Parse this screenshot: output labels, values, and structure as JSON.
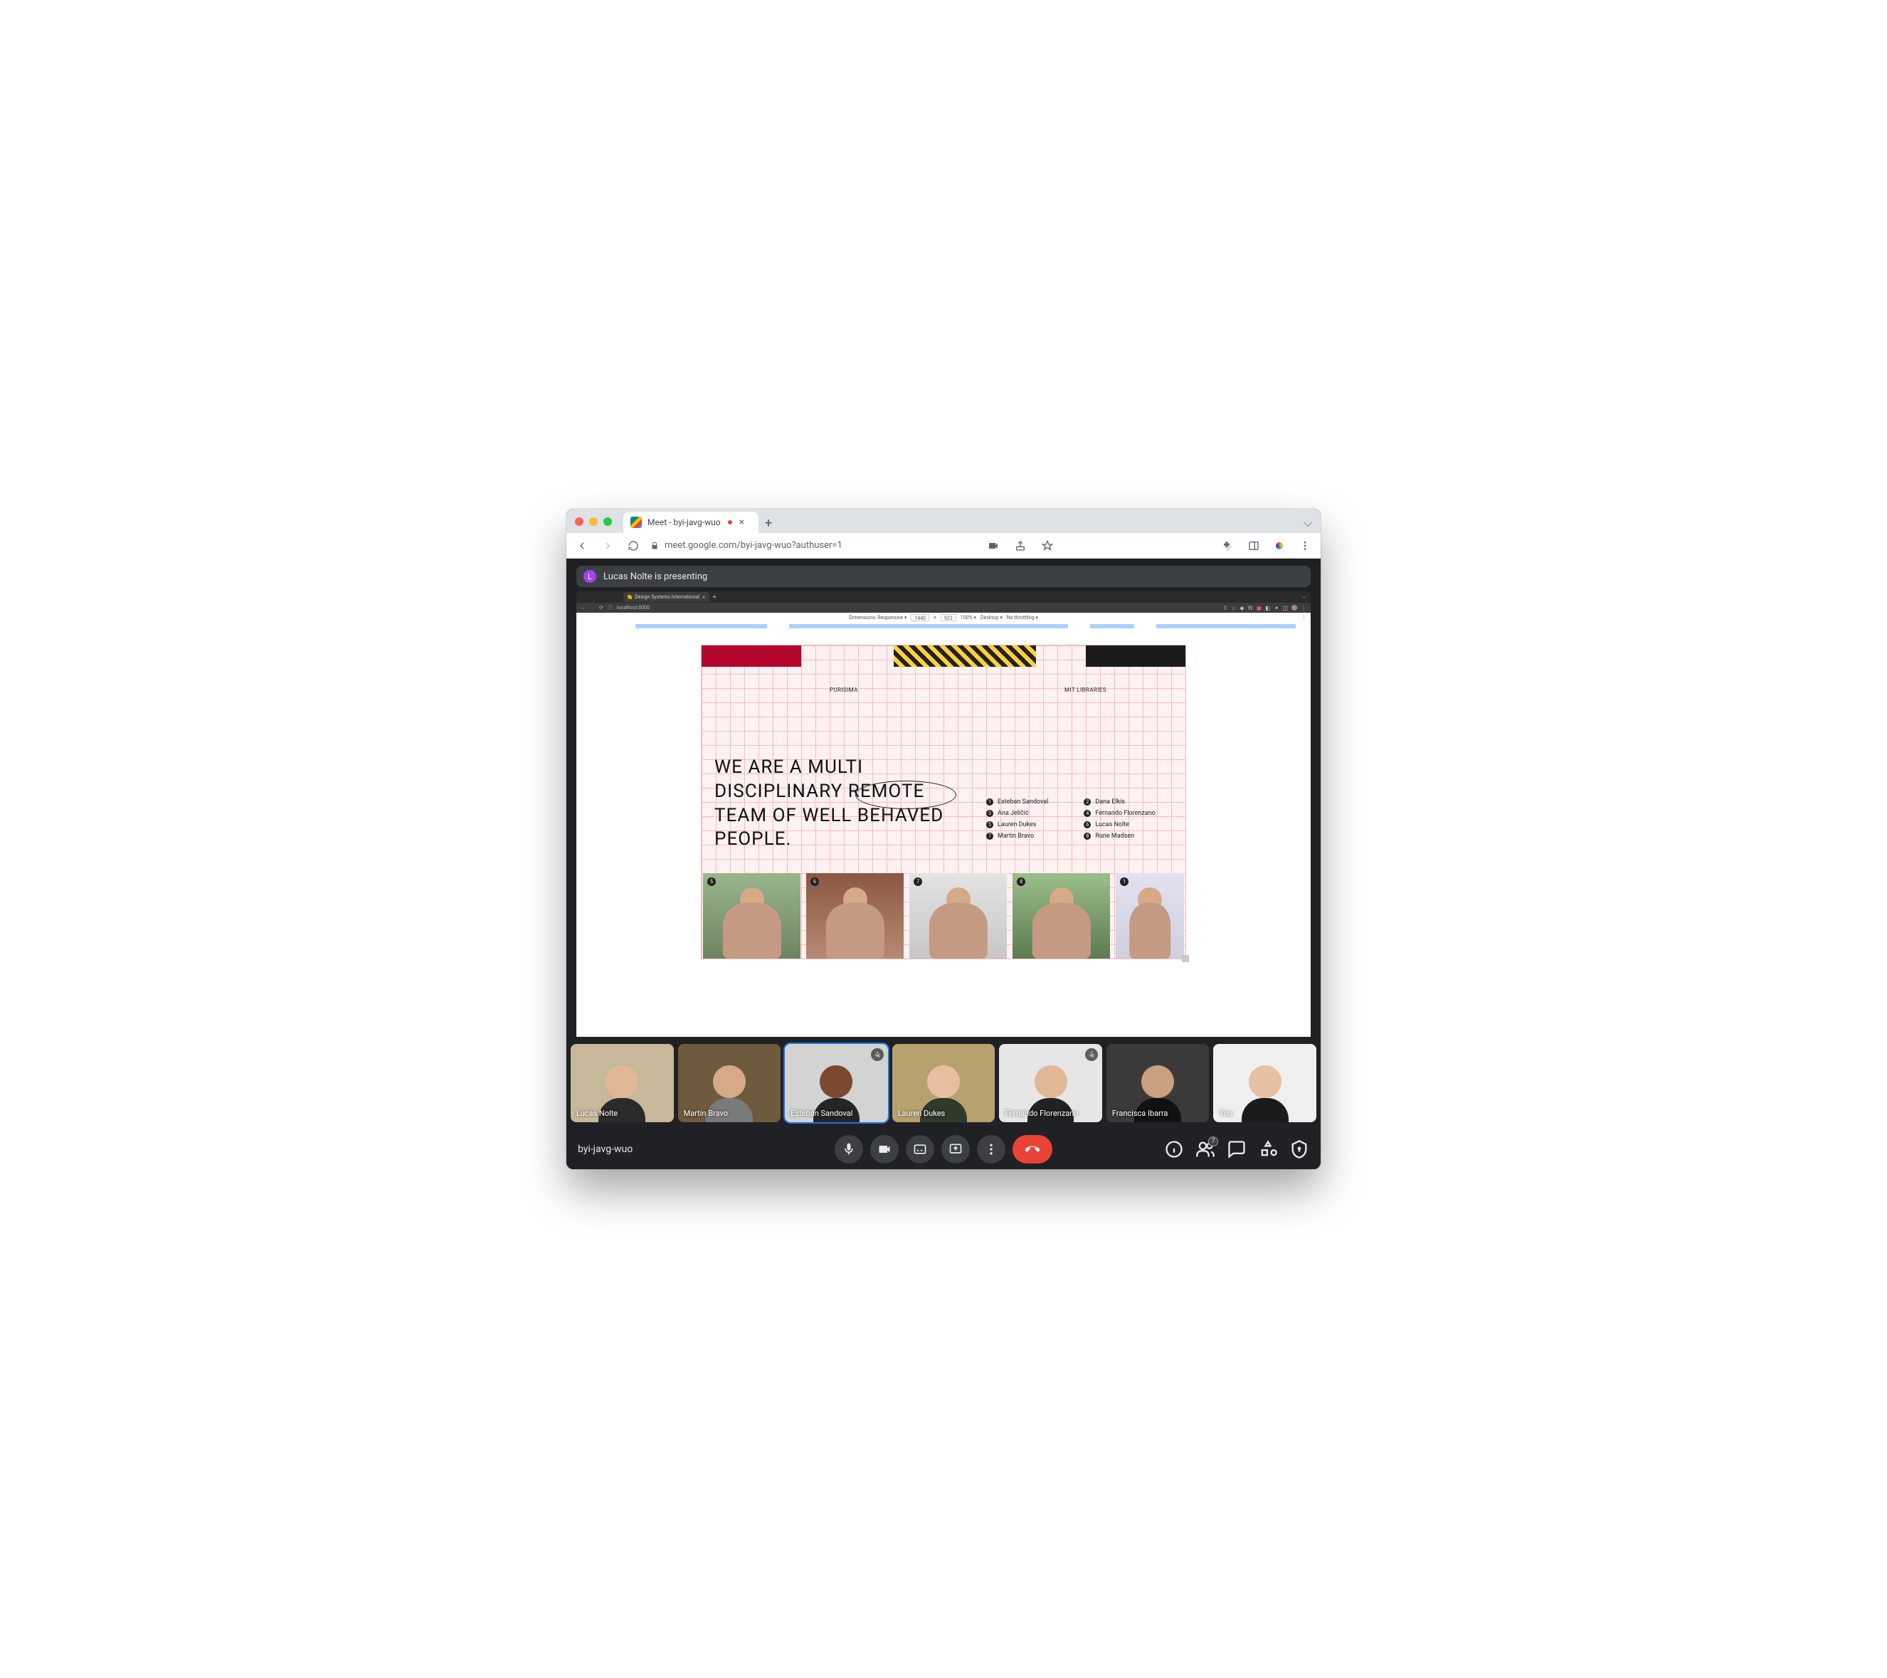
{
  "browser": {
    "tab_title": "Meet - byi-javg-wuo",
    "url": "meet.google.com/byi-javg-wuo?authuser=1"
  },
  "meet": {
    "banner": "Lucas Nolte is presenting",
    "banner_initial": "L",
    "meeting_code": "byi-javg-wuo",
    "participant_count": "7"
  },
  "inner_browser": {
    "tab_title": "Design Systems International",
    "url": "localhost:8000",
    "devtools": {
      "dimensions_label": "Dimensions: Responsive ▾",
      "width": "1440",
      "height": "923",
      "zoom": "100% ▾",
      "device": "Desktop ▾",
      "throttle": "No throttling ▾"
    }
  },
  "page": {
    "projects": {
      "label1": "PURISIMA",
      "label2": "MIT LIBRARIES"
    },
    "headline": "WE ARE A MULTI DISCIPLINARY REMOTE TEAM OF WELL BEHAVED PEOPLE.",
    "team_col1": [
      {
        "n": "1",
        "name": "Esteban Sandoval"
      },
      {
        "n": "3",
        "name": "Ana Jeličić"
      },
      {
        "n": "5",
        "name": "Lauren Dukes"
      },
      {
        "n": "7",
        "name": "Martin Bravo"
      }
    ],
    "team_col2": [
      {
        "n": "2",
        "name": "Dana Elkis"
      },
      {
        "n": "4",
        "name": "Fernando Florenzano"
      },
      {
        "n": "6",
        "name": "Lucas Nolte"
      },
      {
        "n": "8",
        "name": "Rune Madsen"
      }
    ],
    "photo_nums": [
      "5",
      "6",
      "7",
      "8",
      "1"
    ]
  },
  "tiles": [
    {
      "name": "Lucas Nolte",
      "muted": false,
      "speaking": false,
      "bg": "#c7b89a",
      "skin": "#e1b895",
      "shirt": "#2b2b2b"
    },
    {
      "name": "Martin Bravo",
      "muted": false,
      "speaking": false,
      "bg": "#6e5a3d",
      "skin": "#d6a987",
      "shirt": "#7a7a7a"
    },
    {
      "name": "Esteban Sandoval",
      "muted": true,
      "speaking": true,
      "bg": "#d3d3d3",
      "skin": "#7b4a2e",
      "shirt": "#252525"
    },
    {
      "name": "Lauren Dukes",
      "muted": false,
      "speaking": false,
      "bg": "#b7a26f",
      "skin": "#e7bfa0",
      "shirt": "#2f3a2a"
    },
    {
      "name": "Fernando Florenzano",
      "muted": true,
      "speaking": false,
      "bg": "#e6e6e6",
      "skin": "#e1b895",
      "shirt": "#222"
    },
    {
      "name": "Francisca Ibarra",
      "muted": false,
      "speaking": false,
      "bg": "#3a3a3a",
      "skin": "#caa07e",
      "shirt": "#111"
    },
    {
      "name": "You",
      "muted": false,
      "speaking": false,
      "bg": "#efefef",
      "skin": "#e5c0a2",
      "shirt": "#1b1b1b"
    }
  ]
}
